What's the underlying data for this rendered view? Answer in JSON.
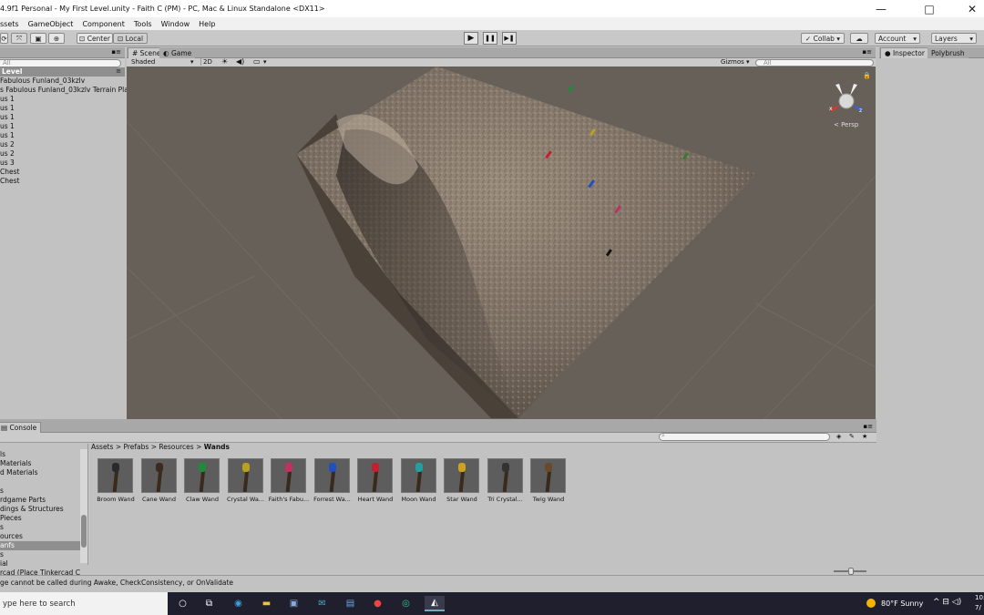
{
  "window": {
    "title": "4.9f1 Personal - My First Level.unity - Faith C (PM) - PC, Mac & Linux Standalone <DX11>",
    "minimize": "—",
    "maximize": "□",
    "close": "✕"
  },
  "menu": [
    "ssets",
    "GameObject",
    "Component",
    "Tools",
    "Window",
    "Help"
  ],
  "toolbar": {
    "center_label": "Center",
    "local_label": "Local",
    "collab_label": "Collab ▾",
    "account_label": "Account",
    "layers_label": "Layers",
    "play": "▶",
    "pause": "❚❚",
    "step": "▶❚"
  },
  "hierarchy": {
    "search_placeholder": "All",
    "root": "Level",
    "items": [
      "Fabulous Funland_03kzlv",
      "s Fabulous Funland_03kzlv Terrain Pla",
      "us 1",
      "us 1",
      "us 1",
      "us 1",
      "us 1",
      "us 2",
      "us 2",
      "us 3",
      "Chest",
      "Chest"
    ]
  },
  "scene": {
    "tab_scene": "Scene",
    "tab_game": "Game",
    "shading": "Shaded",
    "mode_2d": "2D",
    "gizmos": "Gizmos",
    "search_placeholder": "All",
    "persp_label": "< Persp",
    "axis_x": "x",
    "axis_z": "z"
  },
  "inspector": {
    "tab_inspector": "Inspector",
    "tab_polybrush": "Polybrush"
  },
  "console": {
    "tab": "Console",
    "message": "ge cannot be called during Awake, CheckConsistency, or OnValidate"
  },
  "project": {
    "breadcrumb": [
      "Assets",
      "Prefabs",
      "Resources",
      "Wands"
    ],
    "folders": [
      "ls",
      " Materials",
      "d Materials",
      "",
      "s",
      "rdgame Parts",
      "dings & Structures",
      " Pieces",
      "s",
      "ources",
      "anfs",
      "s",
      "ial",
      "rcad (Place Tinkercad C"
    ],
    "selected_folder_index": 10,
    "assets": [
      {
        "name": "Broom Wand",
        "color": "#2a2a2a"
      },
      {
        "name": "Cane Wand",
        "color": "#3a2a20"
      },
      {
        "name": "Claw Wand",
        "color": "#1e8a3a"
      },
      {
        "name": "Crystal Wa...",
        "color": "#b8a020"
      },
      {
        "name": "Faith's Fabu...",
        "color": "#c03060"
      },
      {
        "name": "Forrest Wa...",
        "color": "#2050c0"
      },
      {
        "name": "Heart Wand",
        "color": "#c02030"
      },
      {
        "name": "Moon Wand",
        "color": "#20a0a0"
      },
      {
        "name": "Star Wand",
        "color": "#d0a020"
      },
      {
        "name": "Tri Crystal...",
        "color": "#333333"
      },
      {
        "name": "Twig Wand",
        "color": "#6a4a2a"
      }
    ]
  },
  "taskbar": {
    "search_placeholder": "ype here to search",
    "weather": "80°F  Sunny",
    "time": "10:",
    "date": "7/"
  }
}
